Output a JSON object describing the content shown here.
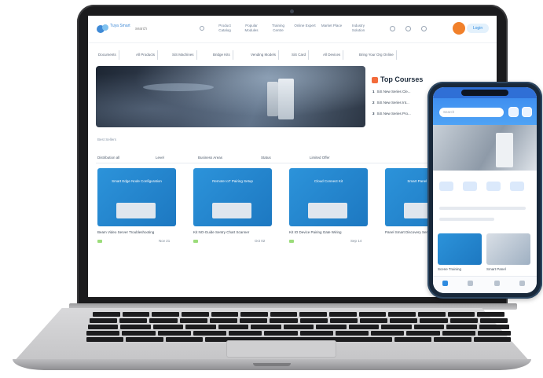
{
  "site": {
    "logo_text": "Tuya Smart",
    "search_stub": "search",
    "nav": [
      "Product Catalog",
      "Popular Modules",
      "Training Centre",
      "Online Expert",
      "Market Place",
      "Industry Solution"
    ],
    "login": "Login"
  },
  "categories": [
    "Documents",
    "All Products",
    "SiS Machines",
    "Bridge Kits",
    "Vending Models",
    "SiS Card",
    "All Devices",
    "Bring Your Org Online"
  ],
  "top_courses": {
    "title": "Top Courses",
    "items": [
      {
        "rank": "1",
        "text": "SiS New Series Cle..."
      },
      {
        "rank": "2",
        "text": "SiS New Series Int..."
      },
      {
        "rank": "3",
        "text": "SiS New Series Pro..."
      }
    ]
  },
  "section_label": "Best Sellers",
  "filters": [
    "Distribution all",
    "Level",
    "Business Areas",
    "Status",
    "Limited Offer"
  ],
  "cards": [
    {
      "title": "Smart Edge Node Configuration",
      "caption": "Beam Video Server Troubleshooting",
      "meta": "Nov 21"
    },
    {
      "title": "Remote IoT Pairing Setup",
      "caption": "Kit NO-Guide Sentry Chart Scanner",
      "meta": "Oct 02"
    },
    {
      "title": "Cloud Connect Kit",
      "caption": "Kit IO Device Pairing Gate Wiring",
      "meta": "Sep 14"
    },
    {
      "title": "Smart Panel Program",
      "caption": "Panel Smart Discovery Series",
      "meta": "Aug 30"
    }
  ],
  "phone": {
    "search_placeholder": "Search",
    "captions": [
      "Scene Training",
      "Smart Panel"
    ]
  },
  "colors": {
    "primary": "#2e8be0",
    "accent": "#f36b3b",
    "card_blue": "#2c93da"
  }
}
